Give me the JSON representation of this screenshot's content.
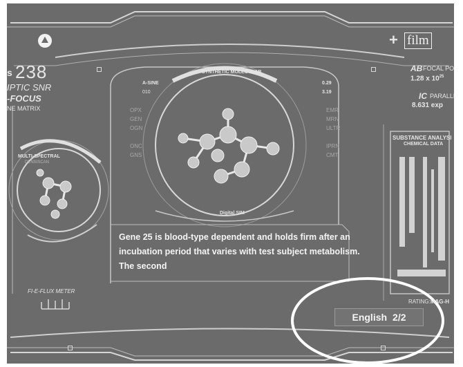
{
  "header": {
    "left_logo_icon": "up-arrow-circle-icon",
    "brand_logo": "film",
    "brand_plus": "+"
  },
  "left_panel": {
    "counter_prefix": "s",
    "counter_value": "238",
    "line1": "IPTIC SNR",
    "line2": "-FOCUS",
    "line3": "NE MATRIX",
    "radar_label": "MULTI-SPECTRAL",
    "radar_sublabel": "DENSISCAN",
    "meter_label": "FI-E-FLUX METER"
  },
  "right_panel": {
    "ab_label": "AB",
    "ab_title": "FOCAL POINT",
    "ab_value": "1.28 x 10",
    "ab_exp": "25",
    "ic_label": "IC",
    "ic_title": "PARALLEL",
    "ic_value": "8.631 exp",
    "analysis_title": "SUBSTANCE ANALYSI",
    "analysis_subtitle": "CHEMICAL DATA",
    "rating_label": "RATING:",
    "rating_value": "MAG-H"
  },
  "center_panel": {
    "arc_title": "SYNTHETIC MOLECULAR",
    "left_top_label": "A-SINE",
    "left_top_value": "010",
    "right_top_value1": "0.29",
    "right_top_value2": "3.19",
    "left_list": [
      "OPX",
      "GEN",
      "OGN",
      "",
      "ONC",
      "GNS"
    ],
    "right_list": [
      "EMR",
      "MRN",
      "ULTR",
      "",
      "IPRN",
      "CMT"
    ],
    "bottom_label": "Digital SIM"
  },
  "subtitles": {
    "line1": "Gene 25 is blood-type dependent and holds firm after an",
    "line2": "incubation period that varies with test subject metabolism.",
    "line3": "The second"
  },
  "language_selector": {
    "language": "English",
    "track": "2/2"
  },
  "colors": {
    "background": "#6b6b6b",
    "lines": "#d8d8d8",
    "highlight_ellipse": "#ffffff"
  }
}
